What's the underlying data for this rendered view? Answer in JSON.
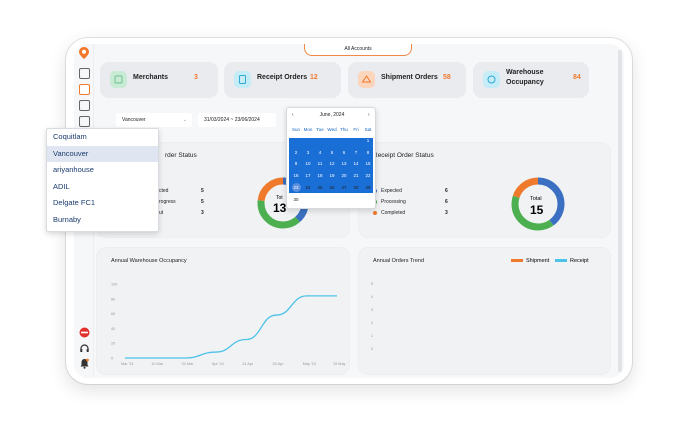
{
  "header": {
    "accounts_label": "All Accounts"
  },
  "stats": [
    {
      "label": "Merchants",
      "value": "3",
      "icon": "merchants-icon",
      "color": "#6cc28f"
    },
    {
      "label": "Receipt Orders",
      "value": "12",
      "icon": "receipt-icon",
      "color": "#5bc6e8"
    },
    {
      "label": "Shipment Orders",
      "value": "58",
      "icon": "shipment-icon",
      "color": "#f07a2c"
    },
    {
      "label": "Warehouse",
      "label2": "Occupancy",
      "value": "84",
      "icon": "warehouse-icon",
      "color": "#5bc6e8"
    }
  ],
  "filters": {
    "warehouse": "Vancouver",
    "date_range": "31/03/2024 ~ 23/06/2024"
  },
  "dropdown": {
    "options": [
      "Coquitlam",
      "Vancouver",
      "ariyanhouse",
      "ADIL",
      "Delgate FC1",
      "Burnaby"
    ],
    "selected": "Vancouver"
  },
  "calendar": {
    "month_label": "June, 2024",
    "prev": "‹",
    "next": "›",
    "weekdays": [
      "Sun",
      "Mon",
      "Tue",
      "Wed",
      "Thu",
      "Fri",
      "Sat"
    ],
    "days": [
      "1",
      "2",
      "3",
      "4",
      "5",
      "6",
      "7",
      "8",
      "9",
      "10",
      "11",
      "12",
      "13",
      "14",
      "15",
      "16",
      "17",
      "18",
      "19",
      "20",
      "21",
      "22",
      "23",
      "24",
      "25",
      "26",
      "27",
      "28",
      "29",
      "30"
    ]
  },
  "shipment_status": {
    "title_part": "rder Status",
    "rows": [
      {
        "label": "cted",
        "count": "5",
        "color": "#3b6fc1"
      },
      {
        "label": "rogress",
        "count": "5",
        "color": "#4caf50"
      },
      {
        "label": "ut",
        "count": "3",
        "color": "#f07a2c"
      }
    ],
    "donut_top": "Tot",
    "donut_value": "13"
  },
  "receipt_status": {
    "title": "Receipt Order Status",
    "rows": [
      {
        "label": "Expected",
        "count": "6",
        "color": "#3b6fc1"
      },
      {
        "label": "Processing",
        "count": "6",
        "color": "#4caf50"
      },
      {
        "label": "Completed",
        "count": "3",
        "color": "#f07a2c"
      }
    ],
    "donut_label": "Total",
    "donut_value": "15"
  },
  "occupancy_chart": {
    "title": "Annual Warehouse Occupancy",
    "y_ticks": [
      "100",
      "80",
      "60",
      "40",
      "20",
      "0"
    ],
    "x_ticks": [
      "Mar '24",
      "10 Mar",
      "24 Mar",
      "Apr '24",
      "14 Apr",
      "28 Apr",
      "May '24",
      "19 May"
    ],
    "line_color": "#4dc3e8"
  },
  "orders_trend": {
    "title": "Annual Orders Trend",
    "legend": [
      {
        "name": "Shipment",
        "color": "#f07a2c"
      },
      {
        "name": "Receipt",
        "color": "#4dc3e8"
      }
    ],
    "y_ticks": [
      "5",
      "4",
      "3",
      "2",
      "1",
      "0"
    ]
  },
  "chart_data": [
    {
      "type": "line",
      "title": "Annual Warehouse Occupancy",
      "x": [
        "Mar '24",
        "10 Mar",
        "24 Mar",
        "Apr '24",
        "14 Apr",
        "28 Apr",
        "May '24",
        "19 May"
      ],
      "series": [
        {
          "values": [
            0,
            0,
            0,
            8,
            25,
            58,
            84,
            84
          ]
        }
      ],
      "ylim": [
        0,
        100
      ]
    },
    {
      "type": "pie",
      "title": "Receipt Order Status",
      "categories": [
        "Expected",
        "Processing",
        "Completed"
      ],
      "values": [
        6,
        6,
        3
      ]
    }
  ]
}
